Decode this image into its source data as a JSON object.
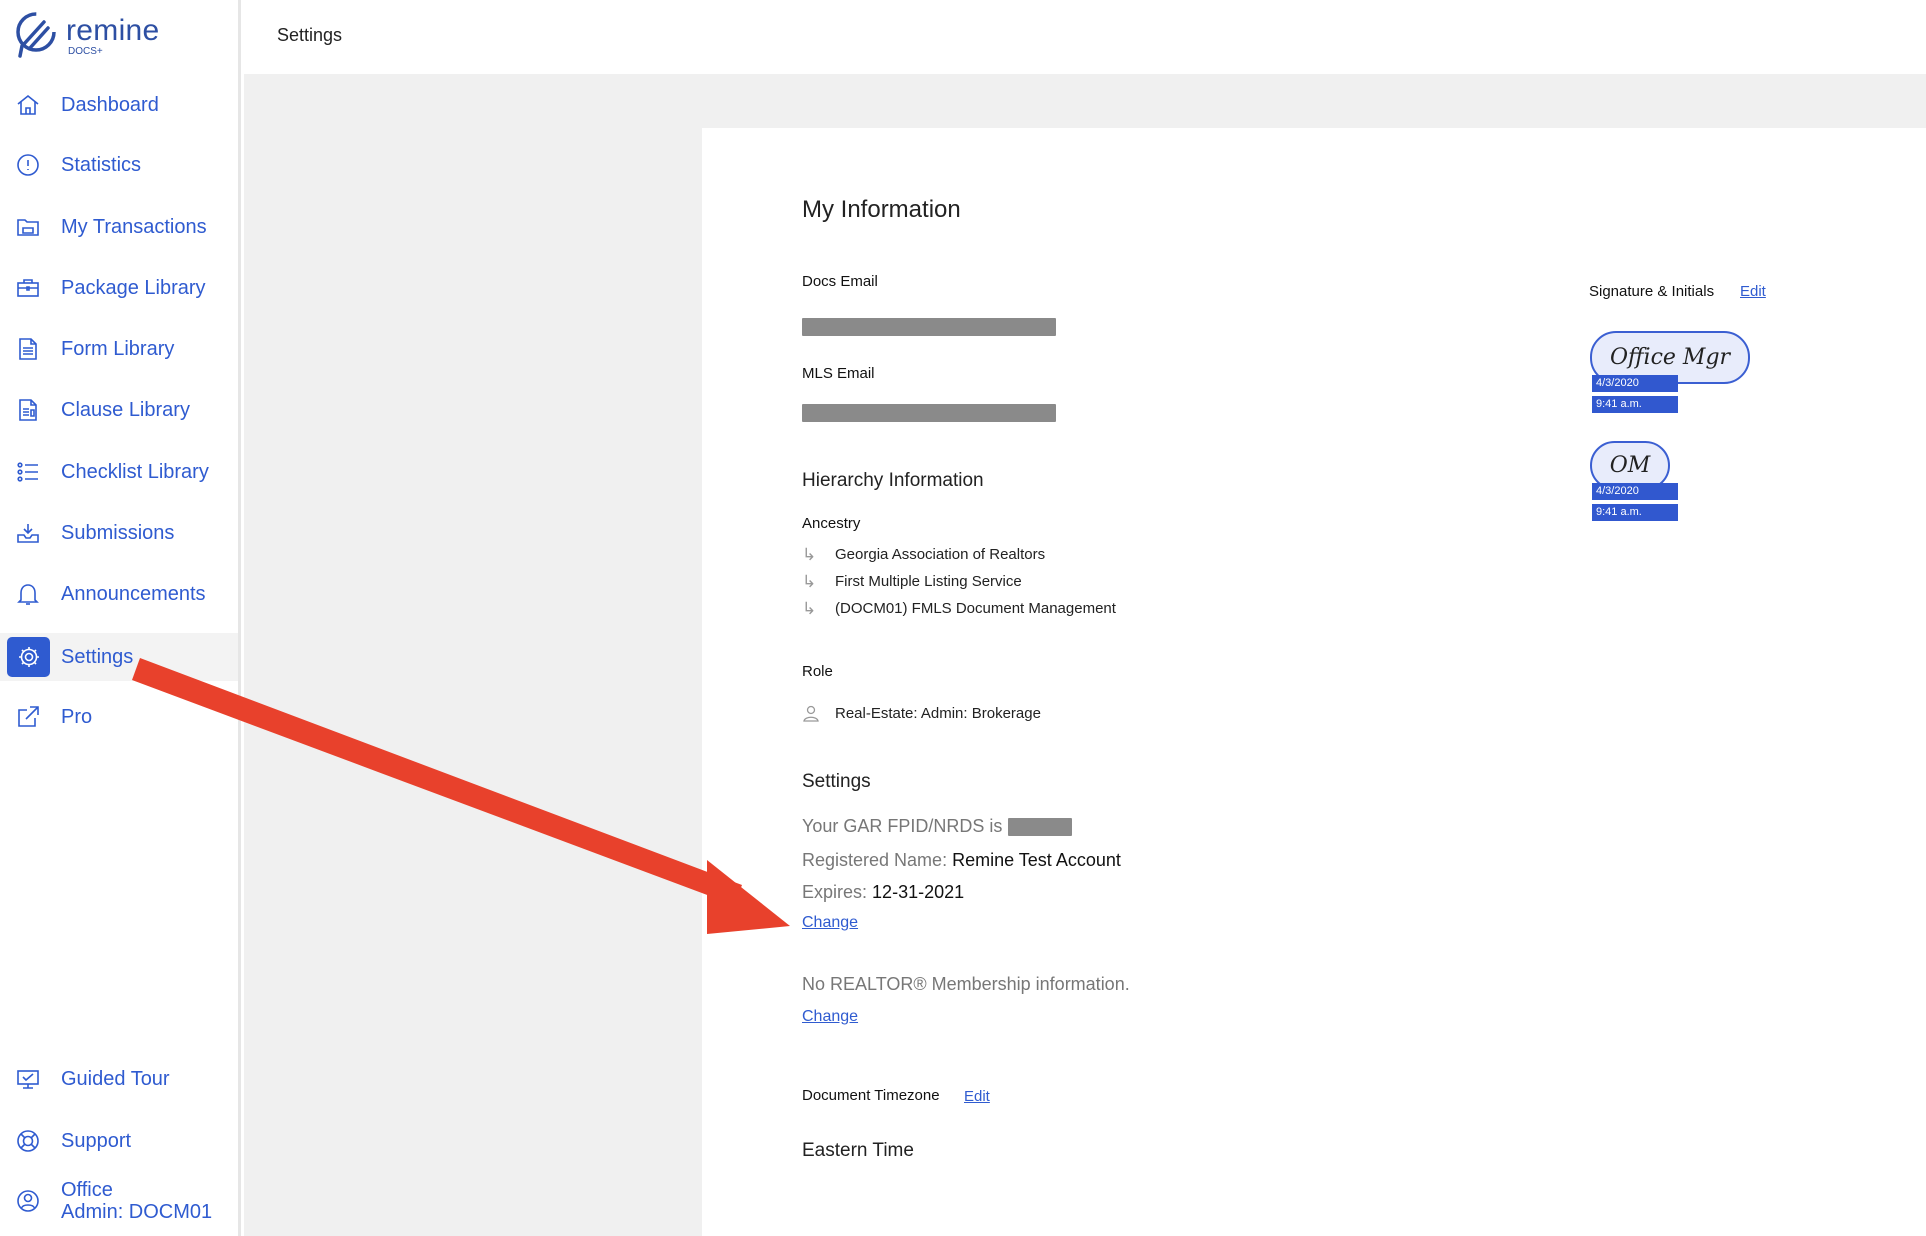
{
  "brand": {
    "name": "remine",
    "sub": "DOCS+"
  },
  "header": {
    "title": "Settings"
  },
  "sidebar": {
    "items": [
      {
        "label": "Dashboard",
        "icon": "home-icon"
      },
      {
        "label": "Statistics",
        "icon": "info-circle-icon"
      },
      {
        "label": "My Transactions",
        "icon": "folder-icon"
      },
      {
        "label": "Package Library",
        "icon": "briefcase-icon"
      },
      {
        "label": "Form Library",
        "icon": "document-icon"
      },
      {
        "label": "Clause Library",
        "icon": "clause-document-icon"
      },
      {
        "label": "Checklist Library",
        "icon": "checklist-icon"
      },
      {
        "label": "Submissions",
        "icon": "inbox-icon"
      },
      {
        "label": "Announcements",
        "icon": "bell-icon"
      },
      {
        "label": "Settings",
        "icon": "gear-icon",
        "active": true
      },
      {
        "label": "Pro",
        "icon": "external-link-icon"
      }
    ],
    "bottom": [
      {
        "label": "Guided Tour",
        "icon": "tour-icon"
      },
      {
        "label": "Support",
        "icon": "lifebuoy-icon"
      },
      {
        "label_line1": "Office",
        "label_line2": "Admin: DOCM01",
        "icon": "user-circle-icon"
      }
    ]
  },
  "my_info": {
    "title": "My Information",
    "docs_email_label": "Docs Email",
    "mls_email_label": "MLS Email"
  },
  "hierarchy": {
    "title": "Hierarchy Information",
    "ancestry_label": "Ancestry",
    "ancestry": [
      "Georgia Association of Realtors",
      "First Multiple Listing Service",
      "(DOCM01) FMLS Document Management"
    ],
    "arrow_glyph": "↳",
    "role_label": "Role",
    "role_value": "Real-Estate: Admin: Brokerage"
  },
  "settings": {
    "title": "Settings",
    "gar_prefix": "Your GAR FPID/NRDS is",
    "registered_label": "Registered Name:",
    "registered_value": "Remine Test Account",
    "expires_label": "Expires:",
    "expires_value": "12-31-2021",
    "change_label": "Change",
    "realtor_text": "No REALTOR® Membership information.",
    "change_label_2": "Change",
    "timezone_label": "Document Timezone",
    "timezone_edit": "Edit",
    "timezone_value": "Eastern Time"
  },
  "signature": {
    "label": "Signature & Initials",
    "edit": "Edit",
    "signature_text": "Office Mgr",
    "initials_text": "OM",
    "date": "4/3/2020",
    "time": "9:41 a.m."
  },
  "colors": {
    "accent": "#2f5bd0",
    "annotation_arrow": "#e8412c",
    "background": "#f0f0f0"
  }
}
